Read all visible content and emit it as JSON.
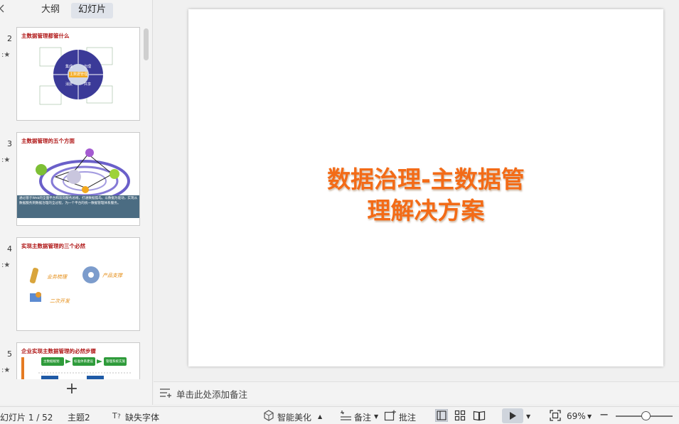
{
  "panel": {
    "tabs": [
      {
        "label": "大纲",
        "active": false
      },
      {
        "label": "幻灯片",
        "active": true
      }
    ],
    "thumbs": [
      {
        "num": "2",
        "title": "主数据管理都管什么",
        "center_label": "主数据管理",
        "quadrants": [
          "集成",
          "治理",
          "消费",
          "共享"
        ]
      },
      {
        "num": "3",
        "title": "主数据管理的五个方面",
        "center_label": "主数据管理",
        "node_labels": [
          "数据标准",
          "平台",
          "考核",
          "流程"
        ],
        "caption": "通过基于Web的全面平台和双向服务总线，打通数据孤岛。以数据为驱动，实现从数据服务到数据治理的全过程，为一个平台的统一数据管理体系服务。"
      },
      {
        "num": "4",
        "title": "实现主数据管理的三个必然",
        "items": [
          "业务梳理",
          "产品支撑",
          "二次开发"
        ]
      },
      {
        "num": "5",
        "title": "企业实现主数据管理的必然步骤",
        "steps": [
          "主数据规划",
          "标准体系建设",
          "管理系统实施"
        ]
      }
    ]
  },
  "slide": {
    "title_line1": "数据治理-主数据管",
    "title_line2": "理解决方案"
  },
  "notes": {
    "placeholder": "单击此处添加备注"
  },
  "status": {
    "slide_counter": "幻灯片 1 / 52",
    "theme": "主题2",
    "missing_font": "缺失字体",
    "beautify": "智能美化",
    "notes": "备注",
    "comment": "批注",
    "zoom": "69%"
  },
  "colors": {
    "title": "#f36b17",
    "thumb_title": "#b01818",
    "ring": "#3b3a98",
    "green": "#3aa63a"
  }
}
